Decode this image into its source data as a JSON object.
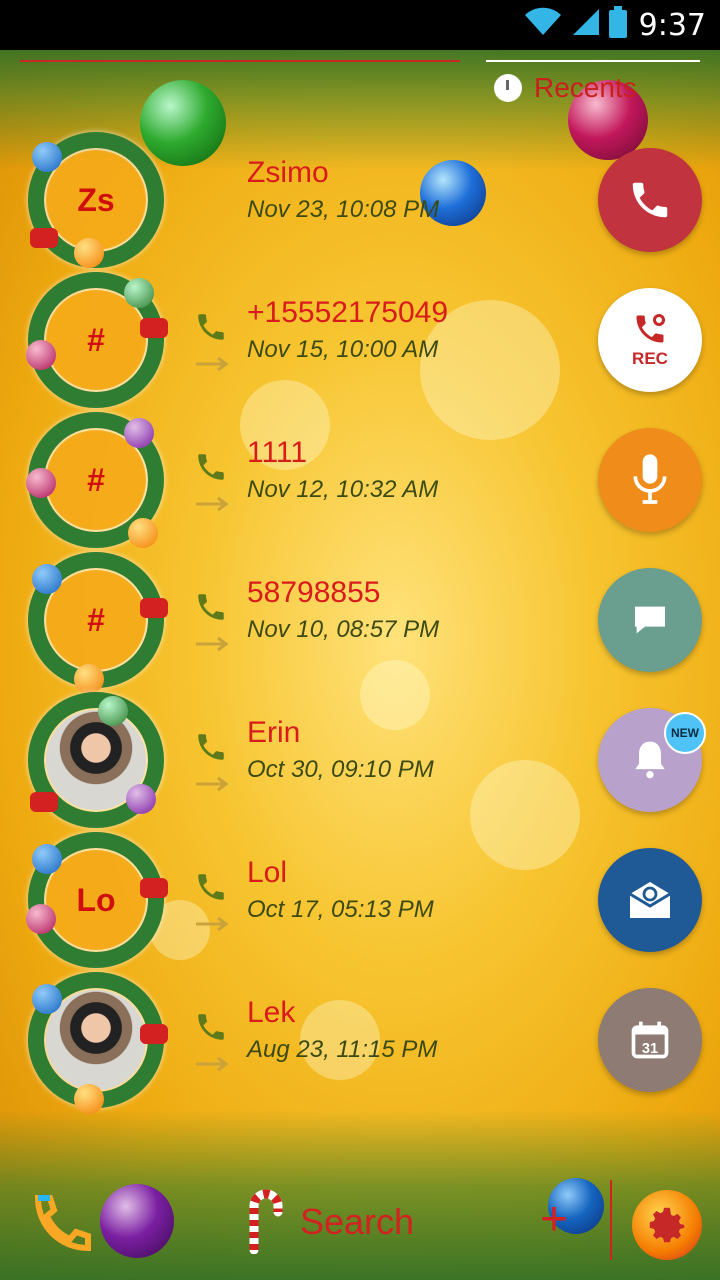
{
  "status_bar": {
    "time": "9:37"
  },
  "header": {
    "tab_label": "Recents"
  },
  "calls": [
    {
      "avatar_text": "Zs",
      "name": "Zsimo",
      "datetime": "Nov 23, 10:08 PM",
      "has_photo": false
    },
    {
      "avatar_text": "#",
      "name": "+15552175049",
      "datetime": "Nov 15, 10:00 AM",
      "has_photo": false
    },
    {
      "avatar_text": "#",
      "name": "1111",
      "datetime": "Nov 12, 10:32 AM",
      "has_photo": false
    },
    {
      "avatar_text": "#",
      "name": "58798855",
      "datetime": "Nov 10, 08:57 PM",
      "has_photo": false
    },
    {
      "avatar_text": "",
      "name": "Erin",
      "datetime": "Oct 30, 09:10 PM",
      "has_photo": true
    },
    {
      "avatar_text": "Lo",
      "name": "Lol",
      "datetime": "Oct 17, 05:13 PM",
      "has_photo": false
    },
    {
      "avatar_text": "",
      "name": "Lek",
      "datetime": "Aug 23, 11:15 PM",
      "has_photo": true
    }
  ],
  "actions": {
    "rec_label": "REC",
    "new_badge": "NEW"
  },
  "bottom_bar": {
    "search_label": "Search",
    "add_label": "+"
  },
  "colors": {
    "call": "#c0333f",
    "rec": "#ffffff",
    "voice": "#ef8c1a",
    "message": "#6a9e8e",
    "reminder": "#b8a2cc",
    "email": "#1f5a96",
    "calendar": "#8d7b74",
    "accent_red": "#d81b1b"
  }
}
